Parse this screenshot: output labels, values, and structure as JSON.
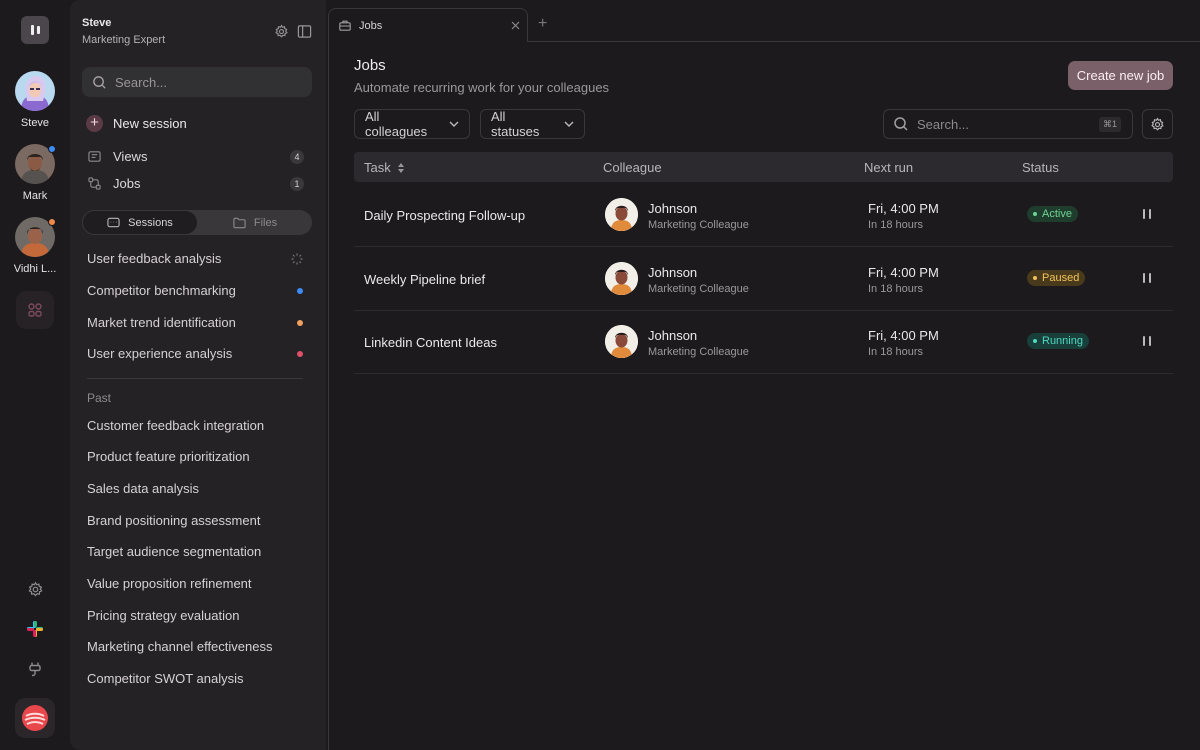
{
  "rail": {
    "users": [
      {
        "name": "Steve",
        "status_color": ""
      },
      {
        "name": "Mark",
        "status_color": "#3d8bf5"
      },
      {
        "name": "Vidhi L...",
        "status_color": "#f08a4b"
      }
    ],
    "icons": [
      "app-logo-icon",
      "group-icon",
      "settings-icon",
      "slack-icon",
      "plug-icon",
      "brand-logo-icon"
    ]
  },
  "sidebar": {
    "user_name": "Steve",
    "user_role": "Marketing Expert",
    "search_placeholder": "Search...",
    "new_session_label": "New session",
    "nav": [
      {
        "label": "Views",
        "count": "4"
      },
      {
        "label": "Jobs",
        "count": "1"
      }
    ],
    "tabs": {
      "sessions": "Sessions",
      "files": "Files"
    },
    "sessions": [
      {
        "label": "User feedback analysis",
        "indicator": "loading"
      },
      {
        "label": "Competitor benchmarking",
        "indicator": "#3d8bf5"
      },
      {
        "label": "Market trend identification",
        "indicator": "#f0a060"
      },
      {
        "label": "User experience analysis",
        "indicator": "#e0506a"
      }
    ],
    "past_heading": "Past",
    "past": [
      "Customer feedback integration",
      "Product feature prioritization",
      "Sales data analysis",
      "Brand positioning assessment",
      "Target audience segmentation",
      "Value proposition refinement",
      "Pricing strategy evaluation",
      "Marketing channel effectiveness",
      "Competitor SWOT analysis"
    ]
  },
  "main": {
    "tab_label": "Jobs",
    "tab_add": "+",
    "title": "Jobs",
    "subtitle": "Automate recurring work for your colleagues",
    "create_button": "Create new job",
    "filters": {
      "colleagues": "All colleagues",
      "statuses": "All statuses"
    },
    "search_placeholder": "Search...",
    "search_shortcut": "⌘1",
    "columns": {
      "task": "Task",
      "colleague": "Colleague",
      "next_run": "Next run",
      "status": "Status"
    },
    "rows": [
      {
        "task": "Daily Prospecting Follow-up",
        "colleague": "Johnson",
        "role": "Marketing Colleague",
        "next_run": "Fri, 4:00 PM",
        "relative": "In 18 hours",
        "status": "Active",
        "status_bg": "#1f3d2c",
        "status_fg": "#6fd396"
      },
      {
        "task": "Weekly Pipeline brief",
        "colleague": "Johnson",
        "role": "Marketing Colleague",
        "next_run": "Fri, 4:00 PM",
        "relative": "In 18 hours",
        "status": "Paused",
        "status_bg": "#4a3a1c",
        "status_fg": "#f1c25a"
      },
      {
        "task": "Linkedin Content Ideas",
        "colleague": "Johnson",
        "role": "Marketing Colleague",
        "next_run": "Fri, 4:00 PM",
        "relative": "In 18 hours",
        "status": "Running",
        "status_bg": "#183f3a",
        "status_fg": "#4fd8c0"
      }
    ]
  }
}
